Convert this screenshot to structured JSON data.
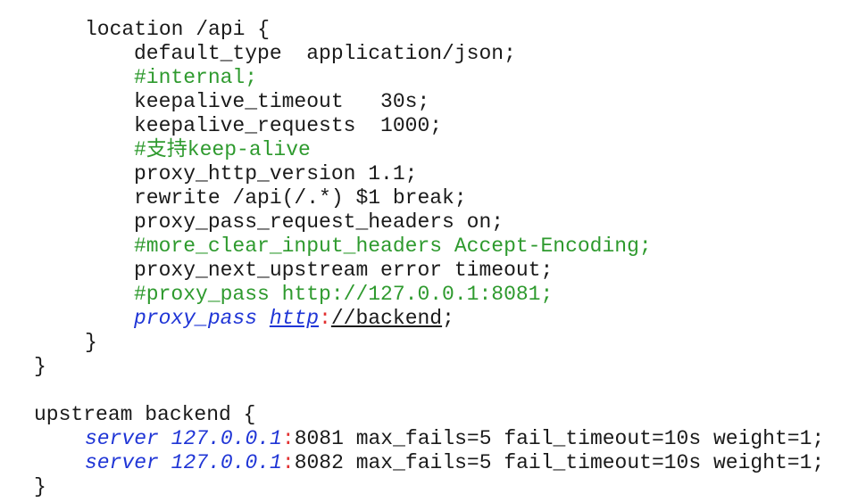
{
  "code": {
    "location_open": "location /api {",
    "default_type": "default_type  application/json;",
    "comment_internal": "#internal;",
    "keepalive_timeout": "keepalive_timeout   30s;",
    "keepalive_requests": "keepalive_requests  1000;",
    "comment_keepalive": "#支持keep-alive",
    "proxy_http_version": "proxy_http_version 1.1;",
    "rewrite": "rewrite /api(/.*) $1 break;",
    "proxy_pass_request_headers": "proxy_pass_request_headers on;",
    "comment_more_clear": "#more_clear_input_headers Accept-Encoding;",
    "proxy_next_upstream": "proxy_next_upstream error timeout;",
    "comment_proxy_pass": "#proxy_pass http://127.0.0.1:8081;",
    "proxy_pass": {
      "keyword": "proxy_pass",
      "scheme": "http",
      "colon": ":",
      "rest": "//backend",
      "semicolon": ";"
    },
    "location_close": "}",
    "server_close": "}",
    "upstream_open": "upstream backend {",
    "servers": [
      {
        "keyword": "server",
        "host": "127.0.0.1",
        "colon": ":",
        "rest": "8081 max_fails=5 fail_timeout=10s weight=1;"
      },
      {
        "keyword": "server",
        "host": "127.0.0.1",
        "colon": ":",
        "rest": "8082 max_fails=5 fail_timeout=10s weight=1;"
      }
    ],
    "upstream_close": "}"
  },
  "colors": {
    "text": "#1a1a1a",
    "comment": "#2e9a2e",
    "keyword": "#1f35d6",
    "colon": "#e23131",
    "background": "#ffffff"
  }
}
